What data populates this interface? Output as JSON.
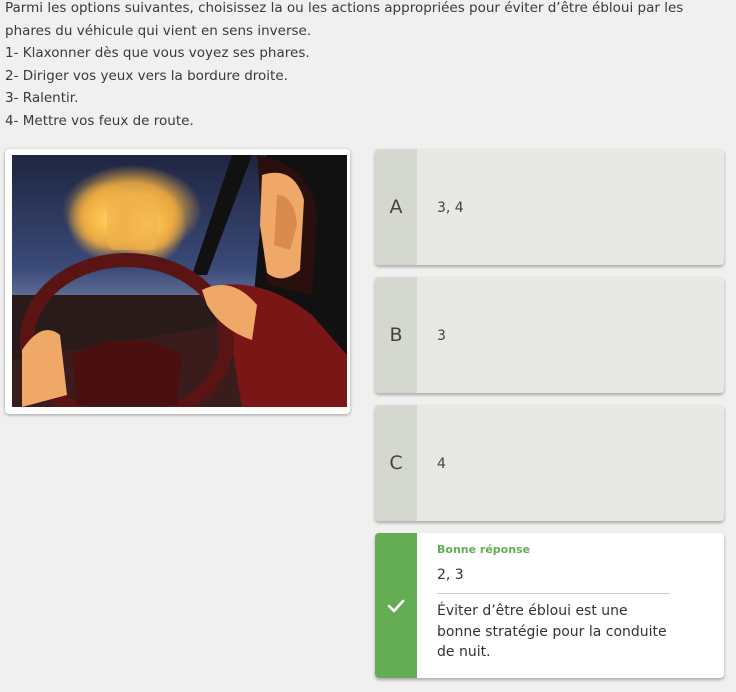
{
  "question": {
    "lines": [
      "Parmi les options suivantes, choisissez la ou les actions appropriées pour éviter d’être ébloui par les",
      "phares du véhicule qui vient en sens inverse.",
      "1- Klaxonner dès que vous voyez ses phares.",
      "2- Diriger vos yeux vers la bordure droite.",
      "3- Ralentir.",
      "4- Mettre vos feux de route."
    ]
  },
  "options": [
    {
      "letter": "A",
      "text": "3, 4"
    },
    {
      "letter": "B",
      "text": "3"
    },
    {
      "letter": "C",
      "text": "4"
    }
  ],
  "correct": {
    "label": "Bonne réponse",
    "value": "2, 3",
    "explanation": "Éviter d’être ébloui est une bonne stratégie pour la conduite de nuit.",
    "icon": "check-icon"
  },
  "colors": {
    "correct_green": "#65ad55",
    "option_bg": "#e8e8e4",
    "letter_bg": "#d4d8cf"
  }
}
